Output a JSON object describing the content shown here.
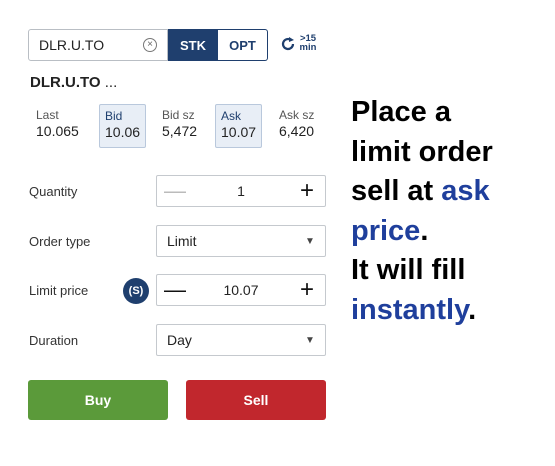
{
  "symbol_input": {
    "value": "DLR.U.TO",
    "clear_glyph": "⊗"
  },
  "segment": {
    "stk": "STK",
    "opt": "OPT",
    "selected": "STK"
  },
  "refresh": {
    "top": ">15",
    "bottom": "min"
  },
  "company": {
    "name": "DLR.U.TO",
    "ellipsis": "..."
  },
  "quotes": [
    {
      "label": "Last",
      "value": "10.065"
    },
    {
      "label": "Bid",
      "value": "10.06"
    },
    {
      "label": "Bid sz",
      "value": "5,472"
    },
    {
      "label": "Ask",
      "value": "10.07"
    },
    {
      "label": "Ask sz",
      "value": "6,420"
    }
  ],
  "order": {
    "quantity": {
      "label": "Quantity",
      "value": "1",
      "minus": "—",
      "plus": "+"
    },
    "order_type": {
      "label": "Order type",
      "value": "Limit"
    },
    "limit_price": {
      "label": "Limit price",
      "value": "10.07",
      "minus": "—",
      "plus": "+",
      "currency_icon": "(S)"
    },
    "duration": {
      "label": "Duration",
      "value": "Day"
    }
  },
  "buttons": {
    "buy": "Buy",
    "sell": "Sell"
  },
  "caption": {
    "line1": "Place a",
    "line2": "limit order",
    "line3a": "sell at ",
    "line3b": "ask",
    "line4a": "price",
    "line4b": ".",
    "line5": "It will fill",
    "line6a": "instantly",
    "line6b": "."
  },
  "colors": {
    "navy": "#1f3f6e",
    "buy": "#5b9a3a",
    "sell": "#c1272d",
    "highlight": "#1f3f9c"
  }
}
